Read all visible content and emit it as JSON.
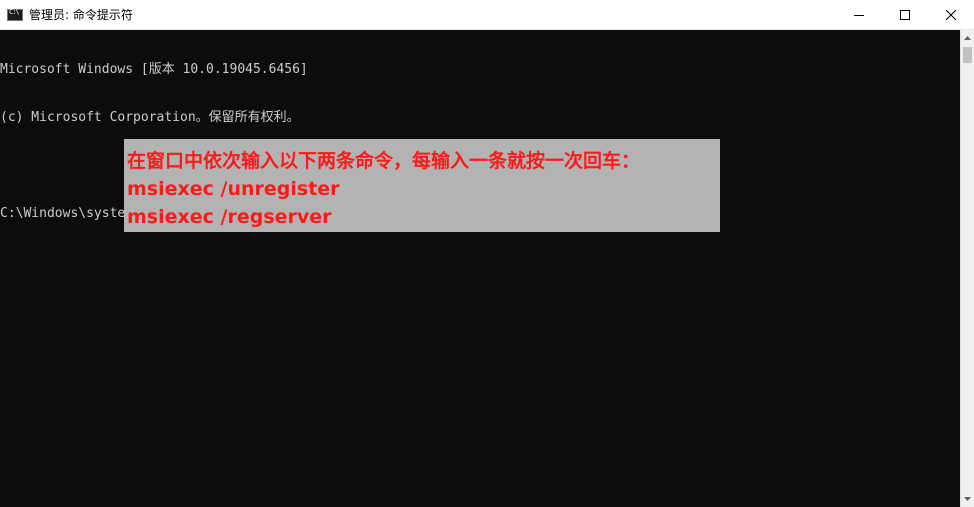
{
  "window": {
    "title": "管理员: 命令提示符",
    "icon": "cmd-icon"
  },
  "caption_buttons": {
    "minimize": "minimize-icon",
    "maximize": "maximize-icon",
    "close": "close-icon"
  },
  "console": {
    "lines": [
      "Microsoft Windows [版本 10.0.19045.6456]",
      "(c) Microsoft Corporation。保留所有权利。",
      "",
      "C:\\Windows\\system32>"
    ]
  },
  "annotation": {
    "line1": "在窗口中依次输入以下两条命令，每输入一条就按一次回车：",
    "line2": "msiexec /unregister",
    "line3": "msiexec /regserver",
    "text_color": "#ff1a1a",
    "background_color": "#b3b3b3"
  },
  "colors": {
    "console_background": "#0c0c0c",
    "console_text": "#cccccc",
    "titlebar_background": "#ffffff"
  }
}
